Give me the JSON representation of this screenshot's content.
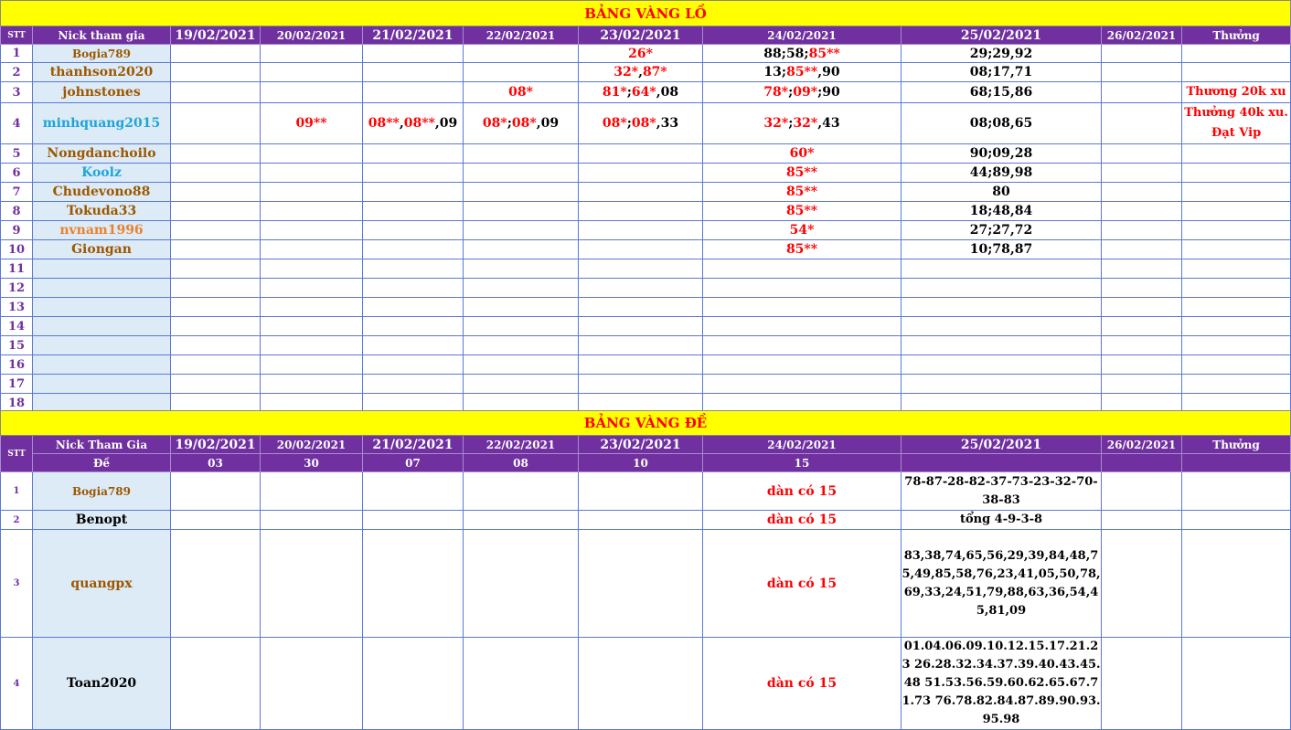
{
  "lo": {
    "title": "BẢNG VÀNG LỒ",
    "headers": {
      "stt": "STT",
      "nick": "Nick tham gia",
      "dates": [
        "19/02/2021",
        "20/02/2021",
        "21/02/2021",
        "22/02/2021",
        "23/02/2021",
        "24/02/2021",
        "25/02/2021",
        "26/02/2021"
      ],
      "reward": "Thưởng"
    },
    "rows": [
      {
        "stt": "1",
        "nick": "Bogia789",
        "color": "brown",
        "small": true,
        "cells": [
          "",
          "",
          "",
          "",
          "26*",
          "88;58;85**",
          "29;29,92",
          "",
          ""
        ]
      },
      {
        "stt": "2",
        "nick": "thanhson2020",
        "color": "brown",
        "cells": [
          "",
          "",
          "",
          "",
          "32*,87*",
          "13;85**,90",
          "08;17,71",
          "",
          ""
        ]
      },
      {
        "stt": "3",
        "nick": "johnstones",
        "color": "brown",
        "cells": [
          "",
          "",
          "",
          "08*",
          "81*;64*,08",
          "78*;09*;90",
          "68;15,86",
          "",
          "Thương 20k xu"
        ]
      },
      {
        "stt": "4",
        "nick": "minhquang2015",
        "color": "blue",
        "cells": [
          "",
          "09**",
          "08**,08**,09",
          "08*;08*,09",
          "08*;08*,33",
          "32*;32*,43",
          "08;08,65",
          "",
          "Thưởng 40k xu. Đạt Vip"
        ]
      },
      {
        "stt": "5",
        "nick": "Nongdanchoilo",
        "color": "brown",
        "cells": [
          "",
          "",
          "",
          "",
          "",
          "60*",
          "90;09,28",
          "",
          ""
        ]
      },
      {
        "stt": "6",
        "nick": "Koolz",
        "color": "blue",
        "cells": [
          "",
          "",
          "",
          "",
          "",
          "85**",
          "44;89,98",
          "",
          ""
        ]
      },
      {
        "stt": "7",
        "nick": "Chudevono88",
        "color": "brown",
        "cells": [
          "",
          "",
          "",
          "",
          "",
          "85**",
          "80",
          "",
          ""
        ]
      },
      {
        "stt": "8",
        "nick": "Tokuda33",
        "color": "brown",
        "cells": [
          "",
          "",
          "",
          "",
          "",
          "85**",
          "18;48,84",
          "",
          ""
        ]
      },
      {
        "stt": "9",
        "nick": "nvnam1996",
        "color": "orange",
        "cells": [
          "",
          "",
          "",
          "",
          "",
          "54*",
          "27;27,72",
          "",
          ""
        ]
      },
      {
        "stt": "10",
        "nick": "Giongan",
        "color": "brown",
        "cells": [
          "",
          "",
          "",
          "",
          "",
          "85**",
          "10;78,87",
          "",
          ""
        ]
      },
      {
        "stt": "11",
        "nick": "",
        "cells": [
          "",
          "",
          "",
          "",
          "",
          "",
          "",
          "",
          ""
        ]
      },
      {
        "stt": "12",
        "nick": "",
        "cells": [
          "",
          "",
          "",
          "",
          "",
          "",
          "",
          "",
          ""
        ]
      },
      {
        "stt": "13",
        "nick": "",
        "cells": [
          "",
          "",
          "",
          "",
          "",
          "",
          "",
          "",
          ""
        ]
      },
      {
        "stt": "14",
        "nick": "",
        "cells": [
          "",
          "",
          "",
          "",
          "",
          "",
          "",
          "",
          ""
        ]
      },
      {
        "stt": "15",
        "nick": "",
        "cells": [
          "",
          "",
          "",
          "",
          "",
          "",
          "",
          "",
          ""
        ]
      },
      {
        "stt": "16",
        "nick": "",
        "cells": [
          "",
          "",
          "",
          "",
          "",
          "",
          "",
          "",
          ""
        ]
      },
      {
        "stt": "17",
        "nick": "",
        "cells": [
          "",
          "",
          "",
          "",
          "",
          "",
          "",
          "",
          ""
        ]
      },
      {
        "stt": "18",
        "nick": "",
        "cells": [
          "",
          "",
          "",
          "",
          "",
          "",
          "",
          "",
          ""
        ]
      }
    ]
  },
  "de": {
    "title": "BẢNG VÀNG ĐỀ",
    "headers": {
      "stt": "STT",
      "nick": "Nick Tham Gia",
      "de_label": "Đề",
      "dates": [
        "19/02/2021",
        "20/02/2021",
        "21/02/2021",
        "22/02/2021",
        "23/02/2021",
        "24/02/2021",
        "25/02/2021",
        "26/02/2021"
      ],
      "results": [
        "03",
        "30",
        "07",
        "08",
        "10",
        "15",
        "",
        ""
      ],
      "reward": "Thưởng"
    },
    "rows": [
      {
        "stt": "1",
        "nick": "Bogia789",
        "color": "brown",
        "small": true,
        "cells": [
          "",
          "",
          "",
          "",
          "",
          "dàn có 15",
          "78-87-28-82-37-73-23-32-70-38-83",
          "",
          ""
        ]
      },
      {
        "stt": "2",
        "nick": "Benopt",
        "color": "black",
        "cells": [
          "",
          "",
          "",
          "",
          "",
          "dàn có 15",
          "tổng 4-9-3-8",
          "",
          ""
        ]
      },
      {
        "stt": "3",
        "nick": "quangpx",
        "color": "brown",
        "cells": [
          "",
          "",
          "",
          "",
          "",
          "dàn có 15",
          "83,38,74,65,56,29,39,84,48,75,49,85,58,76,23,41,05,50,78,69,33,24,51,79,88,63,36,54,45,81,09",
          "",
          ""
        ]
      },
      {
        "stt": "4",
        "nick": "Toan2020",
        "color": "black",
        "cells": [
          "",
          "",
          "",
          "",
          "",
          "dàn có 15",
          "01.04.06.09.10.12.15.17.21.23 26.28.32.34.37.39.40.43.45.48 51.53.56.59.60.62.65.67.71.73 76.78.82.84.87.89.90.93.95.98",
          "",
          ""
        ]
      }
    ]
  }
}
